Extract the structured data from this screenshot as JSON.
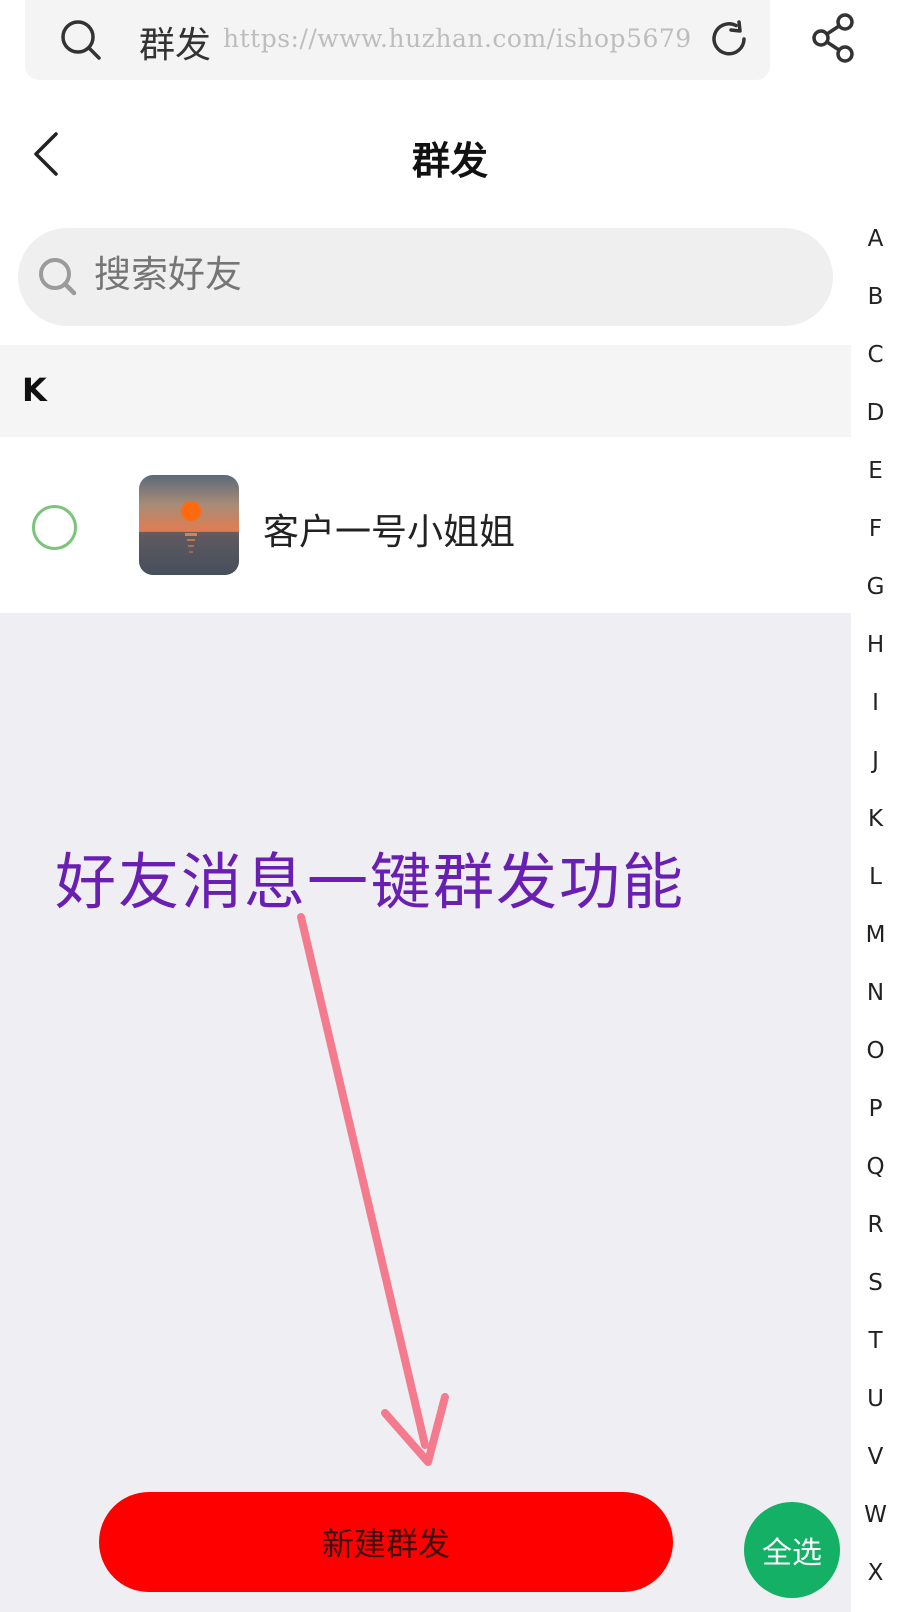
{
  "browser": {
    "title": "群发",
    "watermark": "https://www.huzhan.com/ishop5679"
  },
  "header": {
    "title": "群发"
  },
  "search": {
    "placeholder": "搜索好友"
  },
  "sections": [
    {
      "letter": "K",
      "contacts": [
        {
          "name": "客户一号小姐姐",
          "selected": false
        }
      ]
    }
  ],
  "alphabet": [
    "A",
    "B",
    "C",
    "D",
    "E",
    "F",
    "G",
    "H",
    "I",
    "J",
    "K",
    "L",
    "M",
    "N",
    "O",
    "P",
    "Q",
    "R",
    "S",
    "T",
    "U",
    "V",
    "W",
    "X"
  ],
  "annotation": {
    "text": "好友消息一键群发功能",
    "color": "#6a1fb3",
    "arrow_color": "#f47a8e"
  },
  "buttons": {
    "new_broadcast": "新建群发",
    "select_all": "全选"
  },
  "colors": {
    "primary_button": "#ff0000",
    "select_all": "#13b066",
    "checkbox_border": "#7cc47a"
  }
}
